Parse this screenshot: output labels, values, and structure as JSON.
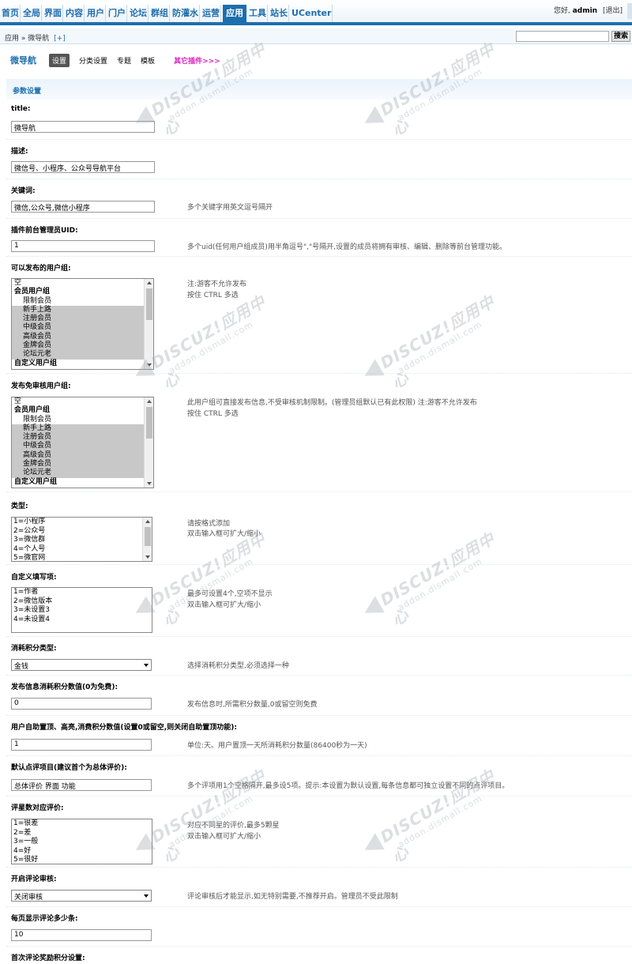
{
  "topnav": {
    "items": [
      "首页",
      "全局",
      "界面",
      "内容",
      "用户",
      "门户",
      "论坛",
      "群组",
      "防灌水",
      "运营",
      "应用",
      "工具",
      "站长",
      "UCenter"
    ],
    "active_index": 10
  },
  "user": {
    "greeting": "您好,",
    "name": "admin",
    "logout": "[退出]"
  },
  "breadcrumb": {
    "root": "应用",
    "separator": "»",
    "current": "微导航",
    "add": "[+]"
  },
  "search": {
    "value": "",
    "button": "搜索"
  },
  "plugin": {
    "title": "微导航",
    "tabs": [
      "设置",
      "分类设置",
      "专题",
      "模板"
    ],
    "active_tab": 0,
    "more": "其它插件>>>"
  },
  "section": {
    "title": "参数设置"
  },
  "fields": {
    "title": {
      "label": "title:",
      "value": "微导航"
    },
    "description": {
      "label": "描述:",
      "value": "微信号、小程序、公众号导航平台"
    },
    "keywords": {
      "label": "关键词:",
      "value": "微信,公众号,微信小程序",
      "tip": "多个关键字用英文逗号隔开"
    },
    "admin_uid": {
      "label": "插件前台管理员UID:",
      "value": "1",
      "tip": "多个uid(任何用户组成员)用半角逗号\",\"号隔开,设置的成员将拥有审核、编辑、删除等前台管理功能。"
    },
    "post_groups": {
      "label": "可以发布的用户组:",
      "tip1": "注:游客不允许发布",
      "tip2": "按住 CTRL 多选",
      "options": [
        "空",
        "会员用户组",
        "限制会员",
        "新手上路",
        "注册会员",
        "中级会员",
        "高级会员",
        "金牌会员",
        "论坛元老",
        "自定义用户组"
      ]
    },
    "exempt_groups": {
      "label": "发布免审核用户组:",
      "tip1": "此用户组可直接发布信息,不受审核机制限制。(管理员组默认已有此权限) 注:游客不允许发布",
      "tip2": "按住 CTRL 多选",
      "options": [
        "空",
        "会员用户组",
        "限制会员",
        "新手上路",
        "注册会员",
        "中级会员",
        "高级会员",
        "金牌会员",
        "论坛元老",
        "自定义用户组"
      ]
    },
    "types": {
      "label": "类型:",
      "tip1": "请按格式添加",
      "tip2": "双击输入框可扩大/缩小",
      "lines": [
        "1=小程序",
        "2=公众号",
        "3=微信群",
        "4=个人号",
        "5=微官网"
      ]
    },
    "custom_fields": {
      "label": "自定义填写项:",
      "tip1": "最多可设置4个,空项不显示",
      "tip2": "双击输入框可扩大/缩小",
      "lines": [
        "1=作者",
        "2=微信版本",
        "3=未设置3",
        "4=未设置4"
      ]
    },
    "credit_type": {
      "label": "消耗积分类型:",
      "value": "金钱",
      "tip": "选择消耗积分类型,必须选择一种"
    },
    "post_cost": {
      "label": "发布信息消耗积分数值(0为免费):",
      "value": "0",
      "tip": "发布信息时,所需积分数量,0或留空则免费"
    },
    "top_cost": {
      "label": "用户自助置顶、高亮,消费积分数值(设置0或留空,则关闭自助置顶功能):",
      "value": "1",
      "tip": "单位:天。用户置顶一天所消耗积分数量(86400秒为一天)"
    },
    "rating_items": {
      "label": "默认点评项目(建议首个为总体评价):",
      "value": "总体评价 界面 功能",
      "tip": "多个评项用1个空格隔开,最多设5项。提示:本设置为默认设置,每条信息都可独立设置不同的点评项目。"
    },
    "rating_levels": {
      "label": "评星数对应评价:",
      "tip1": "对应不同星的评价,最多5颗星",
      "tip2": "双击输入框可扩大/缩小",
      "lines": [
        "1=很差",
        "2=差",
        "3=一般",
        "4=好",
        "5=很好"
      ]
    },
    "comment_review": {
      "label": "开启评论审核:",
      "value": "关闭审核",
      "tip": "评论审核后才能显示,如无特别需要,不推荐开启。管理员不受此限制"
    },
    "per_page": {
      "label": "每页显示评论多少条:",
      "value": "10"
    },
    "first_reward": {
      "label": "首次评论奖励积分设置:"
    }
  },
  "watermark": {
    "brand": "DISCUZ!应用中心",
    "url": "addon.dismall.com",
    "mark": "贰道"
  },
  "colors": {
    "accent": "#1d6eae",
    "more_link": "#e020c0",
    "selected_option": "#c8c8c8"
  }
}
